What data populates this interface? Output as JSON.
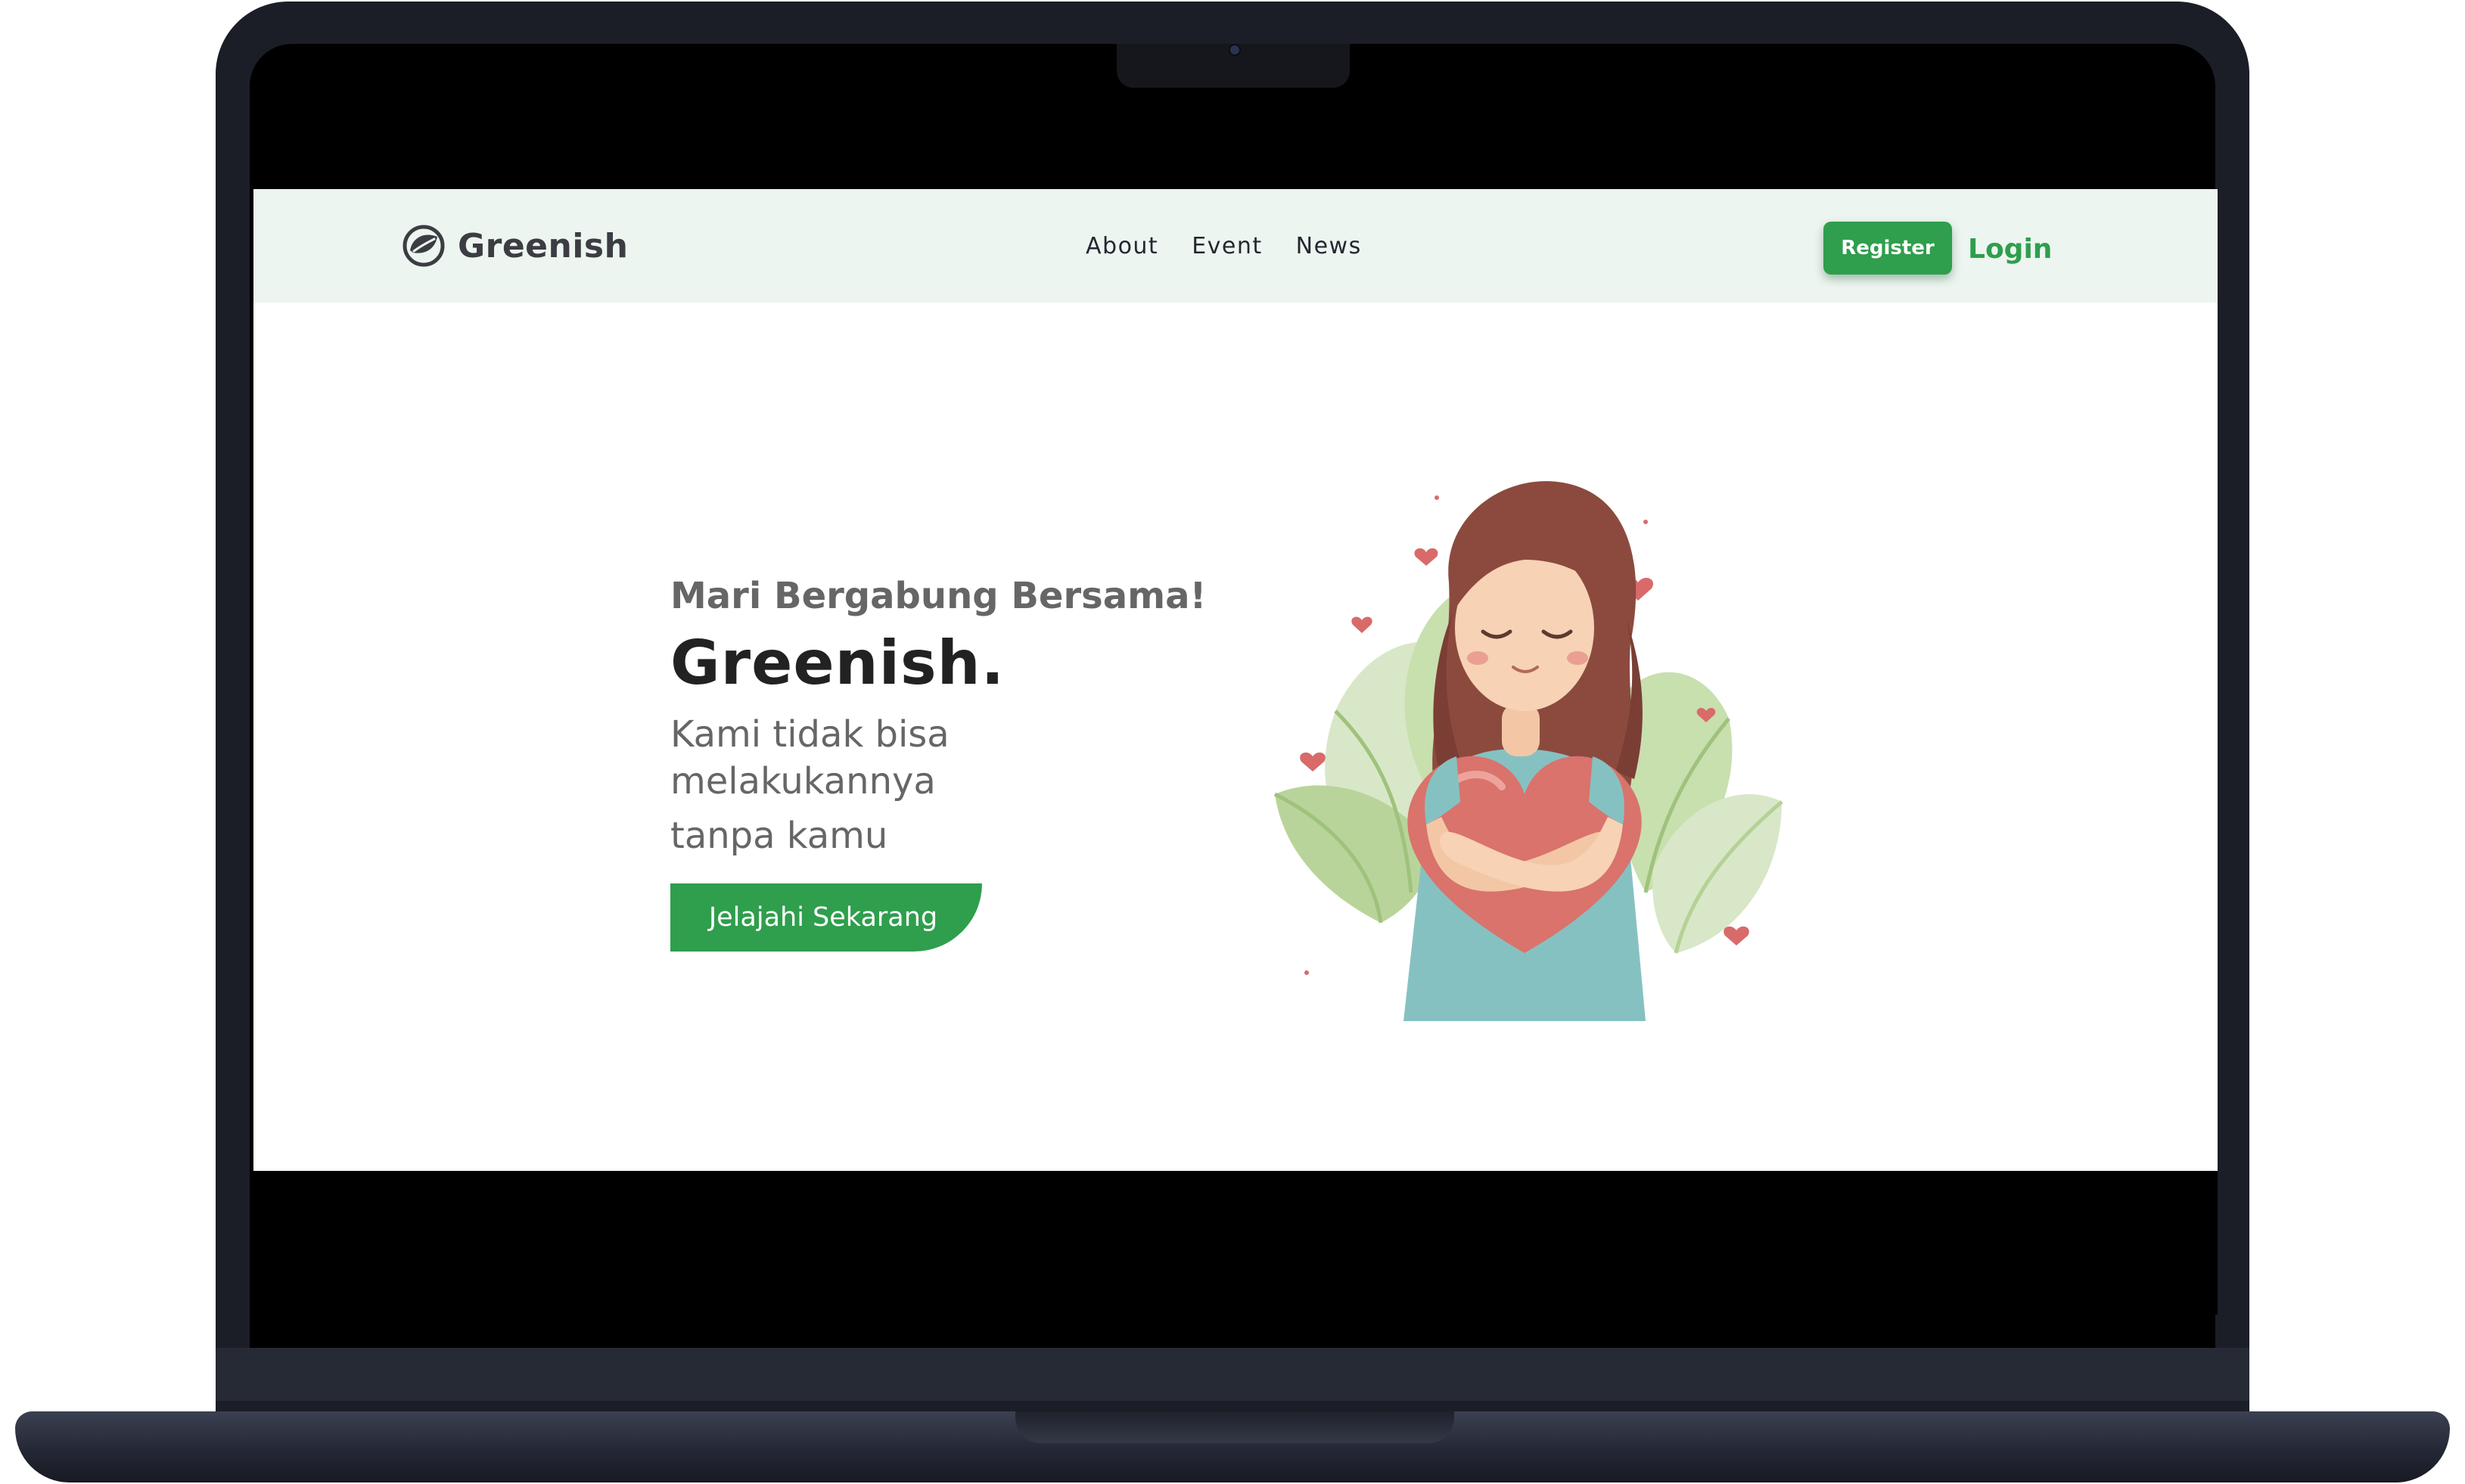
{
  "brand": {
    "name": "Greenish"
  },
  "nav": {
    "links": [
      "About",
      "Event",
      "News"
    ],
    "register_label": "Register",
    "login_label": "Login"
  },
  "hero": {
    "subtitle": "Mari Bergabung Bersama!",
    "title": "Greenish.",
    "tagline_lines": [
      "Kami tidak bisa",
      "melakukannya",
      "tanpa kamu"
    ],
    "cta_label": "Jelajahi Sekarang",
    "illustration": "girl-hugging-heart-illustration"
  },
  "colors": {
    "accent": "#2f9e4d",
    "navbar_bg": "#edf5f0",
    "text_dark": "#222222",
    "text_muted": "#666666"
  },
  "icons": {
    "brand": "leaf-logo-icon"
  }
}
